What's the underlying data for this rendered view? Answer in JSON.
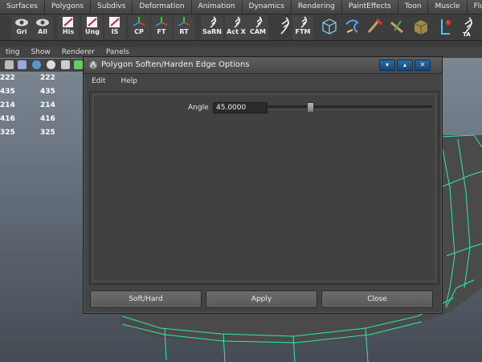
{
  "shelf_tabs": [
    "Surfaces",
    "Polygons",
    "Subdivs",
    "Deformation",
    "Animation",
    "Dynamics",
    "Rendering",
    "PaintEffects",
    "Toon",
    "Muscle",
    "Flu"
  ],
  "shelf_buttons": [
    {
      "label": "Gri",
      "icon": "eye-icon"
    },
    {
      "label": "All",
      "icon": "eye-icon"
    },
    {
      "label": "His",
      "icon": "pencil-icon"
    },
    {
      "label": "Ung",
      "icon": "pencil-icon"
    },
    {
      "label": "IS",
      "icon": "pencil-icon"
    },
    {
      "label": "CP",
      "icon": "axis-icon"
    },
    {
      "label": "FT",
      "icon": "axis-icon"
    },
    {
      "label": "RT",
      "icon": "axis-icon"
    },
    {
      "label": "SaRN",
      "icon": "feather-icon"
    },
    {
      "label": "Act X",
      "icon": "feather-icon"
    },
    {
      "label": "CAM",
      "icon": "feather-icon"
    },
    {
      "label": "FTM",
      "icon": "feather-icon"
    }
  ],
  "panel_menu": [
    "ting",
    "Show",
    "Renderer",
    "Panels"
  ],
  "stats": [
    [
      "222",
      "222"
    ],
    [
      "435",
      "435"
    ],
    [
      "214",
      "214"
    ],
    [
      "416",
      "416"
    ],
    [
      "325",
      "325"
    ]
  ],
  "dialog": {
    "title": "Polygon Soften/Harden Edge Options",
    "menu": [
      "Edit",
      "Help"
    ],
    "angle_label": "Angle",
    "angle_value": "45.0000",
    "angle_slider_fraction": 0.25,
    "buttons": {
      "soft_hard": "Soft/Hard",
      "apply": "Apply",
      "close": "Close"
    }
  }
}
